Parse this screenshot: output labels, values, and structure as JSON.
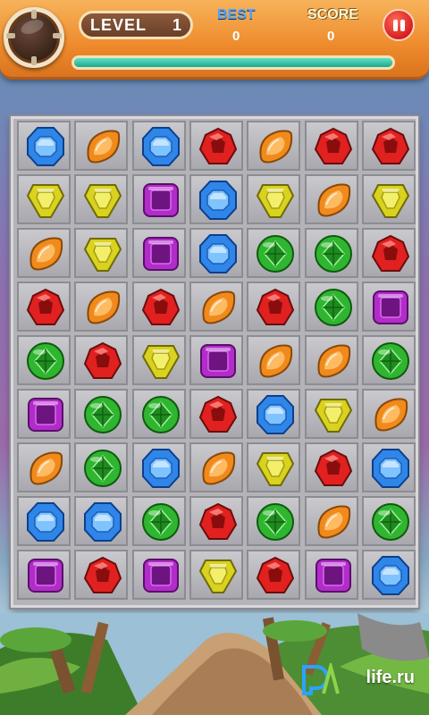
{
  "hud": {
    "level_label": "LEVEL",
    "level_value": "1",
    "best_label": "BEST",
    "best_value": "0",
    "score_label": "SCORE",
    "score_value": "0",
    "progress": 1.0,
    "menu_icon": "round-menu-icon",
    "pause_icon": "pause-icon"
  },
  "board": {
    "columns": 7,
    "rows": 9,
    "grid": [
      [
        "blue",
        "orange",
        "blue",
        "red",
        "orange",
        "red",
        "red"
      ],
      [
        "yellow",
        "yellow",
        "purple",
        "blue",
        "yellow",
        "orange",
        "yellow"
      ],
      [
        "orange",
        "yellow",
        "purple",
        "blue",
        "green",
        "green",
        "red"
      ],
      [
        "red",
        "orange",
        "red",
        "orange",
        "red",
        "green",
        "purple"
      ],
      [
        "green",
        "red",
        "yellow",
        "purple",
        "orange",
        "orange",
        "green"
      ],
      [
        "purple",
        "green",
        "green",
        "red",
        "blue",
        "yellow",
        "orange"
      ],
      [
        "orange",
        "green",
        "blue",
        "orange",
        "yellow",
        "red",
        "blue"
      ],
      [
        "blue",
        "blue",
        "green",
        "red",
        "green",
        "orange",
        "green"
      ],
      [
        "purple",
        "red",
        "purple",
        "yellow",
        "red",
        "purple",
        "blue"
      ]
    ],
    "colors": {
      "blue": "#2f86e8",
      "orange": "#f08a1c",
      "red": "#e0211f",
      "yellow": "#d9d21e",
      "purple": "#b22cc9",
      "green": "#2fb52f"
    }
  },
  "watermark": {
    "text": "life.ru"
  }
}
